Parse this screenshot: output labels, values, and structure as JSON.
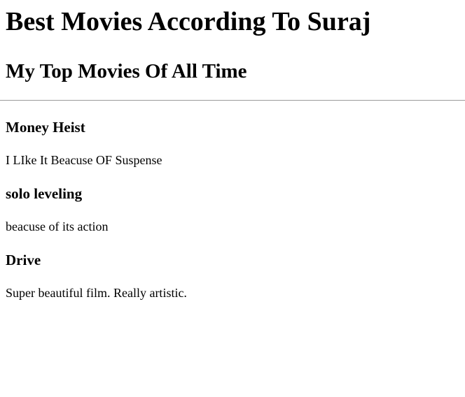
{
  "page": {
    "title": "Best Movies According To Suraj",
    "subtitle": "My Top Movies Of All Time"
  },
  "movies": [
    {
      "title": "Money Heist",
      "reason": "I LIke It Beacuse OF Suspense"
    },
    {
      "title": "solo leveling",
      "reason": "beacuse of its action"
    },
    {
      "title": "Drive",
      "reason": "Super beautiful film. Really artistic."
    }
  ]
}
